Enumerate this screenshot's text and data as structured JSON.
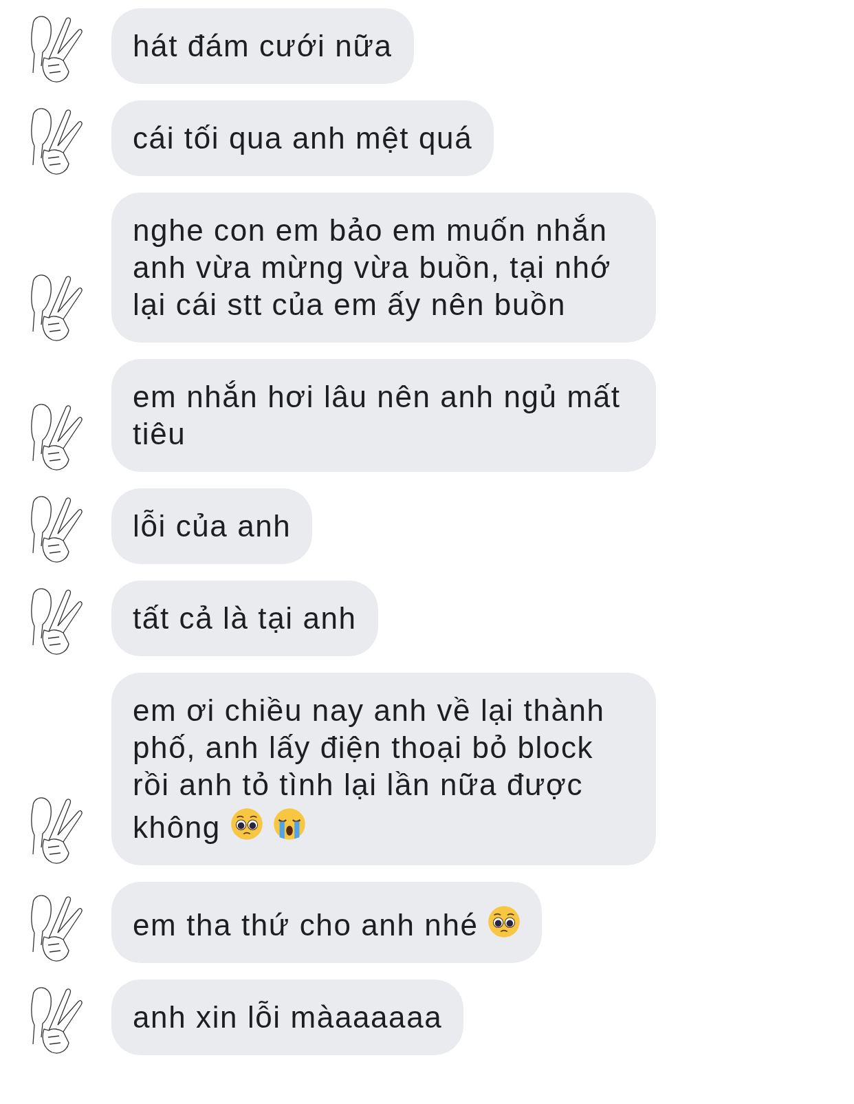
{
  "messages": [
    {
      "text": "hát đám cưới nữa"
    },
    {
      "text": "cái tối qua anh mệt quá"
    },
    {
      "text": "nghe con em bảo em muốn nhắn anh vừa mừng vừa buồn, tại nhớ lại cái stt của em ấy nên buồn"
    },
    {
      "text": "em nhắn hơi lâu nên anh ngủ mất tiêu"
    },
    {
      "text": "lỗi của anh"
    },
    {
      "text": "tất cả là tại anh"
    },
    {
      "text": "em ơi chiều nay anh về lại thành phố, anh lấy điện thoại bỏ block rồi anh tỏ tình lại lần nữa được không",
      "emojis": [
        {
          "kind": "pleading"
        },
        {
          "kind": "crying"
        }
      ]
    },
    {
      "text": "em tha thứ cho anh nhé",
      "emojis": [
        {
          "kind": "pleading"
        }
      ]
    },
    {
      "text": "anh xin lỗi màaaaaaa"
    }
  ]
}
